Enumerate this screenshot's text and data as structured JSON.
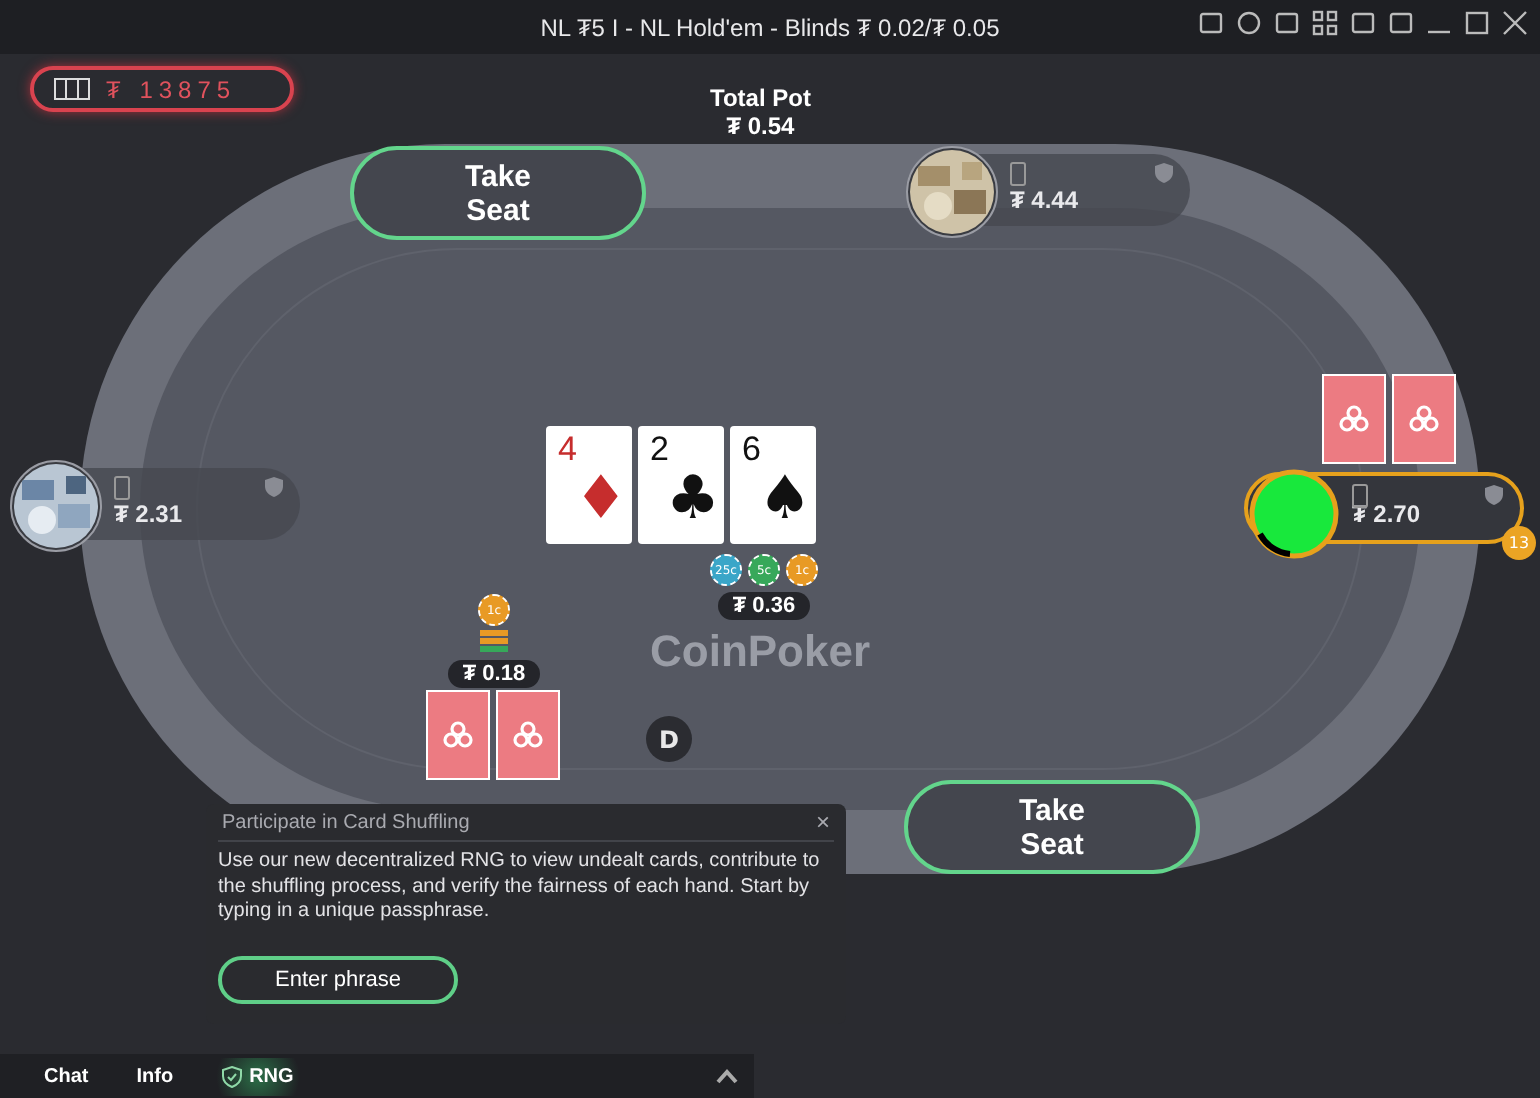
{
  "window": {
    "title": "NL ₮5 I - NL Hold'em - Blinds ₮ 0.02/₮ 0.05"
  },
  "balance": {
    "currency": "₮",
    "amount": "13875"
  },
  "total_pot": {
    "label": "Total Pot",
    "amount": "₮ 0.54"
  },
  "seats": [
    {
      "label": "Take Seat"
    },
    {
      "label": "Take Seat"
    }
  ],
  "players": [
    {
      "stack": "₮ 4.44",
      "active": false,
      "kind": "picture"
    },
    {
      "stack": "₮ 2.31",
      "active": false,
      "kind": "picture"
    },
    {
      "stack": "₮ 2.70",
      "active": true,
      "kind": "color",
      "color": "#18e83c",
      "timer": "13"
    }
  ],
  "logo": "CoinPoker",
  "community_cards": [
    {
      "rank": "4",
      "suit": "♦"
    },
    {
      "rank": "2",
      "suit": "♣"
    },
    {
      "rank": "6",
      "suit": "♠"
    }
  ],
  "pot": {
    "chips": [
      {
        "label": "25c",
        "color": "#3aa6c8"
      },
      {
        "label": "5c",
        "color": "#37a85a"
      },
      {
        "label": "1c",
        "color": "#e89a25"
      }
    ],
    "amount": "₮ 0.36"
  },
  "bet": {
    "chip": "1c",
    "amount": "₮ 0.18"
  },
  "dealer_button": "D",
  "dialog": {
    "title": "Participate in Card Shuffling",
    "close": "×",
    "body": "Use our new decentralized RNG to view undealt cards, contribute to the shuffling process, and verify the fairness of each hand. Start by typing in a unique passphrase.",
    "button": "Enter phrase"
  },
  "bottom_tabs": [
    {
      "label": "Chat",
      "selected": false,
      "kind": "text"
    },
    {
      "label": "Info",
      "selected": false,
      "kind": "text"
    },
    {
      "label": "RNG",
      "selected": true,
      "kind": "shield"
    }
  ]
}
